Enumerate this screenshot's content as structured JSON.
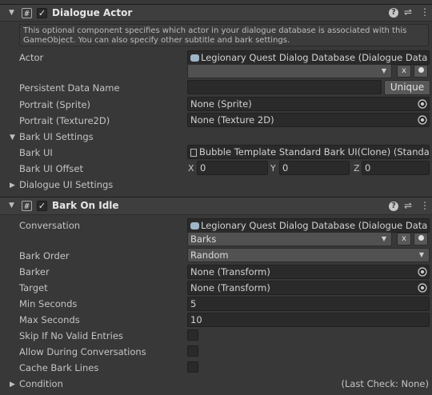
{
  "dialogue_actor": {
    "title": "Dialogue Actor",
    "help_text": "This optional component specifies which actor in your dialogue database is associated with this GameObject. You can also specify other subtitle and bark settings.",
    "actor_label": "Actor",
    "actor_database": "Legionary Quest Dialog Database (Dialogue Data",
    "actor_popup_value": "",
    "clear_button": "x",
    "persistent_label": "Persistent Data Name",
    "persistent_value": "",
    "unique_button": "Unique",
    "portrait_sprite_label": "Portrait (Sprite)",
    "portrait_sprite_value": "None (Sprite)",
    "portrait_tex_label": "Portrait (Texture2D)",
    "portrait_tex_value": "None (Texture 2D)",
    "bark_ui_settings_label": "Bark UI Settings",
    "bark_ui_label": "Bark UI",
    "bark_ui_value": "Bubble Template Standard Bark UI(Clone) (Standa",
    "bark_offset_label": "Bark UI Offset",
    "offset": {
      "x_label": "X",
      "x": "0",
      "y_label": "Y",
      "y": "0",
      "z_label": "Z",
      "z": "0"
    },
    "dialogue_ui_settings_label": "Dialogue UI Settings"
  },
  "bark_on_idle": {
    "title": "Bark On Idle",
    "conversation_label": "Conversation",
    "conversation_database": "Legionary Quest Dialog Database (Dialogue Data",
    "conversation_value": "Barks",
    "clear_button": "x",
    "bark_order_label": "Bark Order",
    "bark_order_value": "Random",
    "barker_label": "Barker",
    "barker_value": "None (Transform)",
    "target_label": "Target",
    "target_value": "None (Transform)",
    "min_seconds_label": "Min Seconds",
    "min_seconds_value": "5",
    "max_seconds_label": "Max Seconds",
    "max_seconds_value": "10",
    "skip_label": "Skip If No Valid Entries",
    "allow_label": "Allow During Conversations",
    "cache_label": "Cache Bark Lines",
    "condition_label": "Condition",
    "last_check": "(Last Check: None)"
  },
  "icons": {
    "help": "?",
    "presets": "⇌",
    "menu": "⋮",
    "check": "✓",
    "script": "#"
  }
}
